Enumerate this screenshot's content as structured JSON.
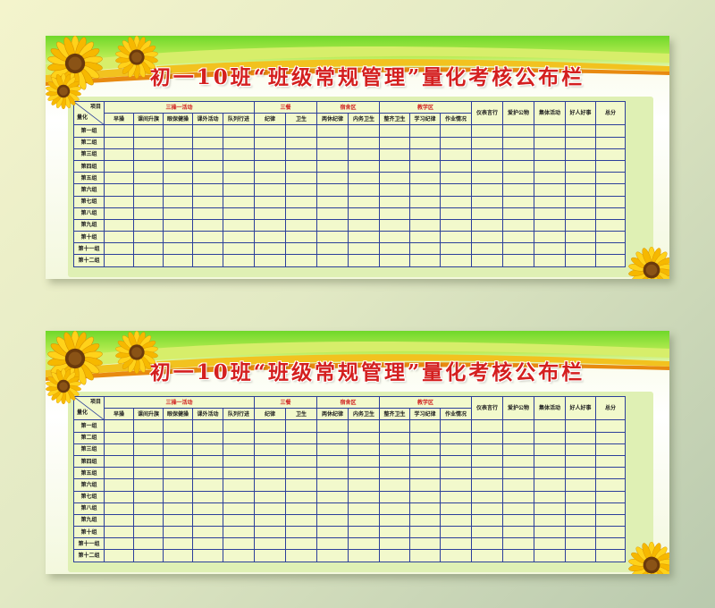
{
  "title": "初一10班“班级常规管理”量化考核公布栏",
  "corner": {
    "item": "项目",
    "quant": "量化"
  },
  "groups": {
    "g1": "三操一活动",
    "g2": "三餐",
    "g3": "宿舍区",
    "g4": "教学区"
  },
  "columns": [
    "早操",
    "课间升旗",
    "眼保健操",
    "课外活动",
    "队列行进",
    "纪律",
    "卫生",
    "两休纪律",
    "内务卫生",
    "整齐卫生",
    "学习纪律",
    "作业情况",
    "仪表言行",
    "爱护公物",
    "集体活动",
    "好人好事",
    "总分"
  ],
  "rows": [
    "第一组",
    "第二组",
    "第三组",
    "第四组",
    "第五组",
    "第六组",
    "第七组",
    "第八组",
    "第九组",
    "第十组",
    "第十一组",
    "第十二组"
  ],
  "colors": {
    "title": "#d41f1f",
    "grid_line": "#2c3f9a",
    "cell_bg": "#f2f9cc",
    "panel_bg": "#dff0b4",
    "band_green": "#6fd82a"
  },
  "icons": [
    "sunflower-icon"
  ]
}
